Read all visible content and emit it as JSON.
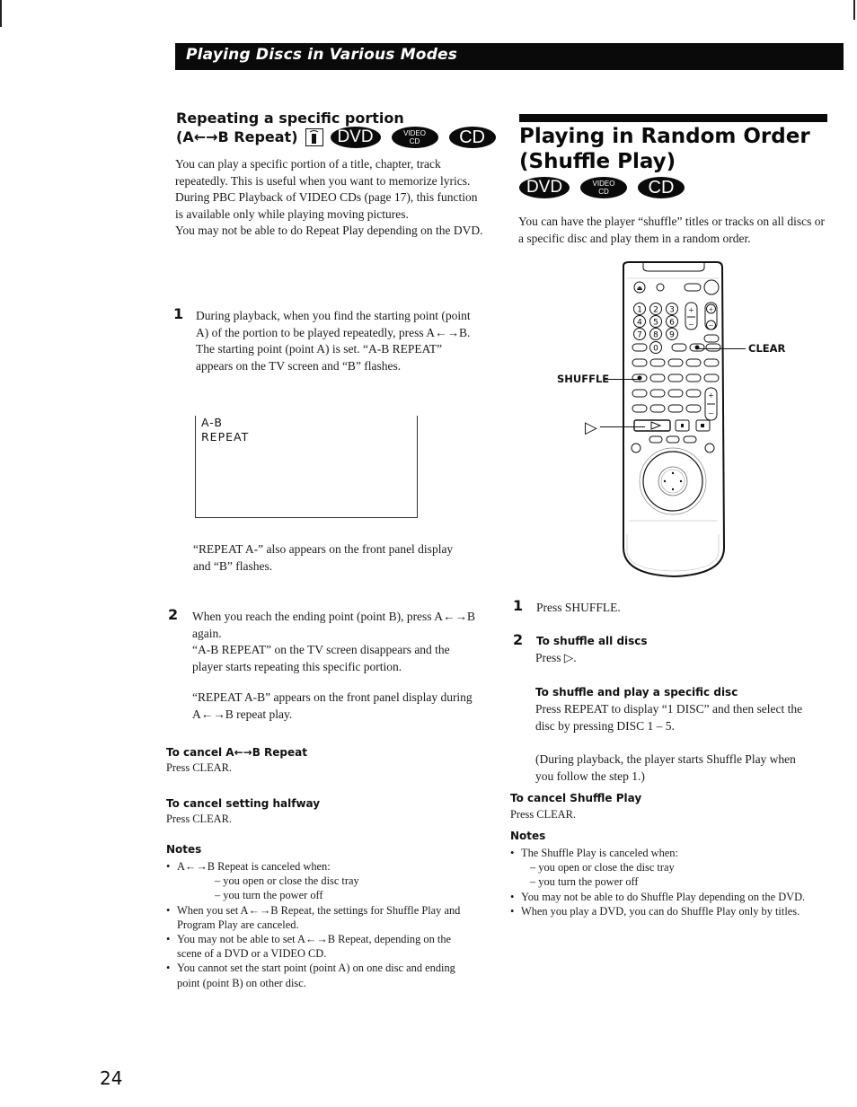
{
  "header": {
    "title": "Playing Discs in Various Modes"
  },
  "left": {
    "heading_line1": "Repeating a specific portion",
    "heading_line2": "(A←→B Repeat)",
    "badges": {
      "dvd": "DVD",
      "vcd_top": "VIDEO",
      "vcd_bottom": "CD",
      "cd": "CD"
    },
    "intro": [
      "You can play a specific portion of a title, chapter, track repeatedly. This is useful when you want to memorize lyrics.",
      "During PBC Playback of VIDEO CDs (page 17), this function is available only while playing moving pictures.",
      "You may not be able to do Repeat Play depending on the DVD."
    ],
    "step1": {
      "num": "1",
      "text": "During playback, when you find the starting point (point A) of the portion to be played repeatedly, press A←→B.",
      "result": "The starting point (point A) is set.  “A-B REPEAT” appears on the TV screen and  “B” flashes."
    },
    "tv_screen": {
      "line1": "A-B",
      "line2": "REPEAT"
    },
    "front_panel_note1": "“REPEAT A-” also appears on the front panel display and “B” flashes.",
    "step2": {
      "num": "2",
      "text": "When you reach the ending point (point B), press A←→B again.",
      "result": "“A-B REPEAT” on the TV screen disappears and the player starts repeating this specific portion.",
      "front_panel": "“REPEAT A-B” appears on the front panel display during A←→B repeat play."
    },
    "cancel_repeat": {
      "heading": "To cancel A←→B Repeat",
      "text": "Press CLEAR."
    },
    "cancel_halfway": {
      "heading": "To cancel setting halfway",
      "text": "Press CLEAR."
    },
    "notes": {
      "heading": "Notes",
      "items": [
        {
          "text": "A←→B Repeat is canceled when:",
          "subs": [
            "– you open or close the disc tray",
            "– you turn the power off"
          ]
        },
        {
          "text": "When you set A←→B Repeat, the settings for Shuffle Play and Program Play are canceled."
        },
        {
          "text": "You may not be able to set A←→B Repeat, depending on the scene of a DVD or a VIDEO CD."
        },
        {
          "text": "You cannot set the start point (point A) on one disc and ending point (point B) on other disc."
        }
      ]
    }
  },
  "right": {
    "title_line1": "Playing in Random Order",
    "title_line2": "(Shuffle Play)",
    "badges": {
      "dvd": "DVD",
      "vcd_top": "VIDEO",
      "vcd_bottom": "CD",
      "cd": "CD"
    },
    "intro": "You can have the player “shuffle” titles or tracks on all discs or a specific disc and play them in a random order.",
    "remote_labels": {
      "clear": "CLEAR",
      "shuffle": "SHUFFLE",
      "play": "▷"
    },
    "remote_digits": [
      "1",
      "2",
      "3",
      "4",
      "5",
      "6",
      "7",
      "8",
      "9",
      "0"
    ],
    "step1": {
      "num": "1",
      "text": "Press SHUFFLE."
    },
    "step2": {
      "num": "2",
      "heading_all": "To shuffle all discs",
      "text_all": "Press ▷.",
      "heading_specific": "To shuffle and play a specific disc",
      "text_specific": "Press REPEAT to display “1 DISC” and then select the disc by pressing DISC 1 – 5.",
      "during_playback": "(During playback, the player starts Shuffle Play when you follow the step 1.)"
    },
    "cancel_shuffle": {
      "heading": "To cancel Shuffle Play",
      "text": "Press CLEAR."
    },
    "notes": {
      "heading": "Notes",
      "items": [
        {
          "text": "The Shuffle Play is canceled when:",
          "subs": [
            "– you open or close the disc tray",
            "– you turn the power off"
          ]
        },
        {
          "text": "You may not be able to do Shuffle Play depending on the DVD."
        },
        {
          "text": "When you play a DVD, you can do Shuffle Play only by titles."
        }
      ]
    }
  },
  "page_number": "24"
}
